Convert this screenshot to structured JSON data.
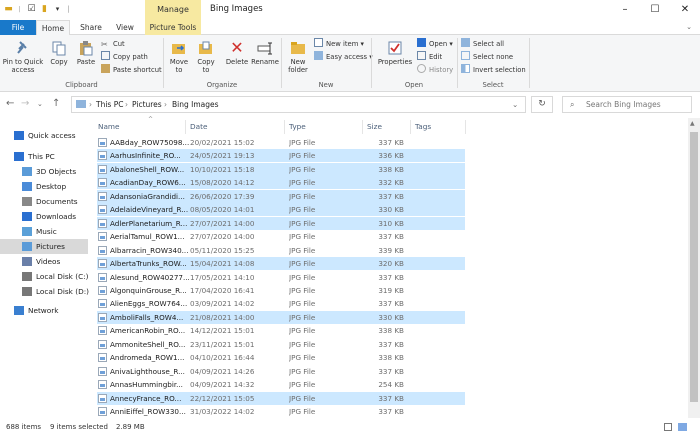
{
  "title": {
    "contextual_tab": "Manage",
    "window_title": "Bing Images"
  },
  "tabs": {
    "file": "File",
    "home": "Home",
    "share": "Share",
    "view": "View",
    "picture_tools": "Picture Tools"
  },
  "ribbon": {
    "pin": "Pin to Quick access",
    "pin1": "Pin to Quick",
    "pin2": "access",
    "copy": "Copy",
    "paste": "Paste",
    "cut": "Cut",
    "copy_path": "Copy path",
    "paste_shortcut": "Paste shortcut",
    "move_to1": "Move",
    "move_to2": "to",
    "copy_to1": "Copy",
    "copy_to2": "to",
    "delete": "Delete",
    "rename": "Rename",
    "new_folder1": "New",
    "new_folder2": "folder",
    "new_item": "New item",
    "easy_access": "Easy access",
    "properties": "Properties",
    "open": "Open",
    "edit": "Edit",
    "history": "History",
    "select_all": "Select all",
    "select_none": "Select none",
    "invert_selection": "Invert selection",
    "group_clipboard": "Clipboard",
    "group_organize": "Organize",
    "group_new": "New",
    "group_open": "Open",
    "group_select": "Select"
  },
  "address": {
    "crumbs": [
      "This PC",
      "Pictures",
      "Bing Images"
    ],
    "search_placeholder": "Search Bing Images"
  },
  "nav": [
    {
      "label": "Quick access",
      "icon": "star-icon"
    },
    {
      "label": "This PC",
      "icon": "pc-icon"
    },
    {
      "label": "3D Objects",
      "icon": "cube-icon"
    },
    {
      "label": "Desktop",
      "icon": "desktop-icon"
    },
    {
      "label": "Documents",
      "icon": "documents-icon"
    },
    {
      "label": "Downloads",
      "icon": "downloads-icon"
    },
    {
      "label": "Music",
      "icon": "music-icon"
    },
    {
      "label": "Pictures",
      "icon": "pictures-icon"
    },
    {
      "label": "Videos",
      "icon": "videos-icon"
    },
    {
      "label": "Local Disk (C:)",
      "icon": "disk-icon"
    },
    {
      "label": "Local Disk (D:)",
      "icon": "disk-icon"
    },
    {
      "label": "Network",
      "icon": "network-icon"
    }
  ],
  "columns": {
    "name": "Name",
    "date": "Date",
    "type": "Type",
    "size": "Size",
    "tags": "Tags"
  },
  "files": [
    {
      "name": "AABday_ROW75098...",
      "date": "20/02/2021 15:02",
      "type": "JPG File",
      "size": "337 KB",
      "selected": false
    },
    {
      "name": "AarhusInfinite_RO...",
      "date": "24/05/2021 19:13",
      "type": "JPG File",
      "size": "336 KB",
      "selected": true
    },
    {
      "name": "AbaloneShell_ROW...",
      "date": "10/10/2021 15:18",
      "type": "JPG File",
      "size": "338 KB",
      "selected": true
    },
    {
      "name": "AcadianDay_ROW6...",
      "date": "15/08/2020 14:12",
      "type": "JPG File",
      "size": "332 KB",
      "selected": true
    },
    {
      "name": "AdansoniaGrandidi...",
      "date": "26/06/2020 17:39",
      "type": "JPG File",
      "size": "337 KB",
      "selected": true
    },
    {
      "name": "AdelaideVineyard_R...",
      "date": "08/05/2020 14:01",
      "type": "JPG File",
      "size": "330 KB",
      "selected": true
    },
    {
      "name": "AdlerPlanetarium_R...",
      "date": "27/07/2021 14:00",
      "type": "JPG File",
      "size": "310 KB",
      "selected": true
    },
    {
      "name": "AerialTamul_ROW1...",
      "date": "27/07/2020 14:00",
      "type": "JPG File",
      "size": "337 KB",
      "selected": false
    },
    {
      "name": "Albarracin_ROW340...",
      "date": "05/11/2020 15:25",
      "type": "JPG File",
      "size": "339 KB",
      "selected": false
    },
    {
      "name": "AlbertaTrunks_ROW...",
      "date": "15/04/2021 14:08",
      "type": "JPG File",
      "size": "320 KB",
      "selected": true
    },
    {
      "name": "Alesund_ROW40277...",
      "date": "17/05/2021 14:10",
      "type": "JPG File",
      "size": "337 KB",
      "selected": false
    },
    {
      "name": "AlgonquinGrouse_R...",
      "date": "17/04/2020 16:41",
      "type": "JPG File",
      "size": "319 KB",
      "selected": false
    },
    {
      "name": "AlienEggs_ROW764...",
      "date": "03/09/2021 14:02",
      "type": "JPG File",
      "size": "337 KB",
      "selected": false
    },
    {
      "name": "AmboliFalls_ROW4...",
      "date": "21/08/2021 14:00",
      "type": "JPG File",
      "size": "330 KB",
      "selected": true
    },
    {
      "name": "AmericanRobin_RO...",
      "date": "14/12/2021 15:01",
      "type": "JPG File",
      "size": "338 KB",
      "selected": false
    },
    {
      "name": "AmmoniteShell_RO...",
      "date": "23/11/2021 15:01",
      "type": "JPG File",
      "size": "337 KB",
      "selected": false
    },
    {
      "name": "Andromeda_ROW1...",
      "date": "04/10/2021 16:44",
      "type": "JPG File",
      "size": "338 KB",
      "selected": false
    },
    {
      "name": "AnivaLighthouse_R...",
      "date": "04/09/2021 14:26",
      "type": "JPG File",
      "size": "337 KB",
      "selected": false
    },
    {
      "name": "AnnasHummingbir...",
      "date": "04/09/2021 14:32",
      "type": "JPG File",
      "size": "254 KB",
      "selected": false
    },
    {
      "name": "AnnecyFrance_RO...",
      "date": "22/12/2021 15:05",
      "type": "JPG File",
      "size": "337 KB",
      "selected": true
    },
    {
      "name": "AnniEiffel_ROW330...",
      "date": "31/03/2022 14:02",
      "type": "JPG File",
      "size": "337 KB",
      "selected": false
    }
  ],
  "status": {
    "count": "688 items",
    "selected": "9 items selected",
    "size": "2.89 MB"
  }
}
